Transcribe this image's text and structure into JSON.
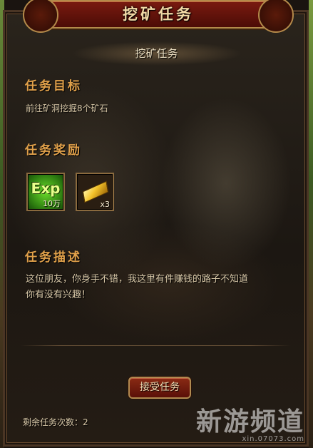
{
  "window": {
    "title": "挖矿任务"
  },
  "panel": {
    "subtitle": "挖矿任务",
    "goal": {
      "heading": "任务目标",
      "text": "前往矿洞挖掘8个矿石"
    },
    "rewards": {
      "heading": "任务奖励",
      "items": [
        {
          "label": "Exp",
          "count": "10万",
          "icon": "exp-icon"
        },
        {
          "count": "x3",
          "icon": "gold-bar-icon"
        }
      ]
    },
    "description": {
      "heading": "任务描述",
      "line1": "这位朋友，你身手不错，我这里有件赚钱的路子不知道",
      "line2": "你有没有兴趣！"
    },
    "accept_label": "接受任务",
    "remaining": "剩余任务次数：2"
  },
  "watermark": {
    "main": "新游频道",
    "url": "xin.07073.com"
  }
}
